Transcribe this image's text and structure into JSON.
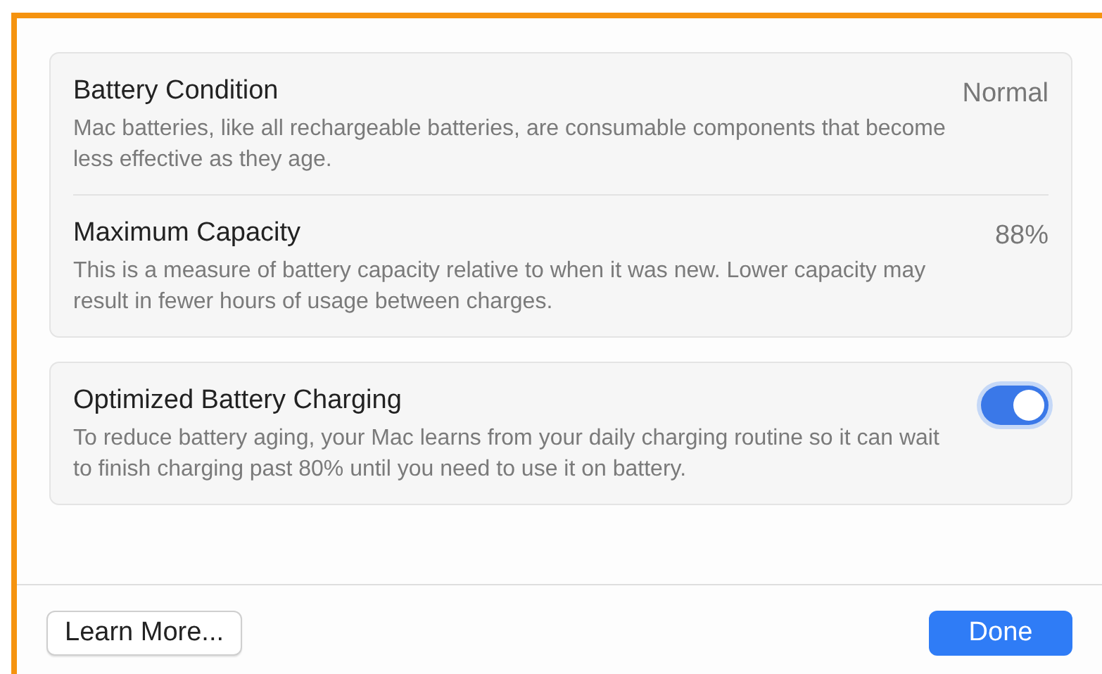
{
  "cards": [
    {
      "rows": [
        {
          "kind": "value",
          "title": "Battery Condition",
          "description": "Mac batteries, like all rechargeable batteries, are consumable components that become less effective as they age.",
          "value": "Normal"
        },
        {
          "kind": "value",
          "title": "Maximum Capacity",
          "description": "This is a measure of battery capacity relative to when it was new. Lower capacity may result in fewer hours of usage between charges.",
          "value": "88%"
        }
      ]
    },
    {
      "rows": [
        {
          "kind": "toggle",
          "title": "Optimized Battery Charging",
          "description": "To reduce battery aging, your Mac learns from your daily charging routine so it can wait to finish charging past 80% until you need to use it on battery.",
          "on": true
        }
      ]
    }
  ],
  "buttons": [
    {
      "label": "Learn More...",
      "kind": "secondary"
    },
    {
      "label": "Done",
      "kind": "primary"
    }
  ]
}
